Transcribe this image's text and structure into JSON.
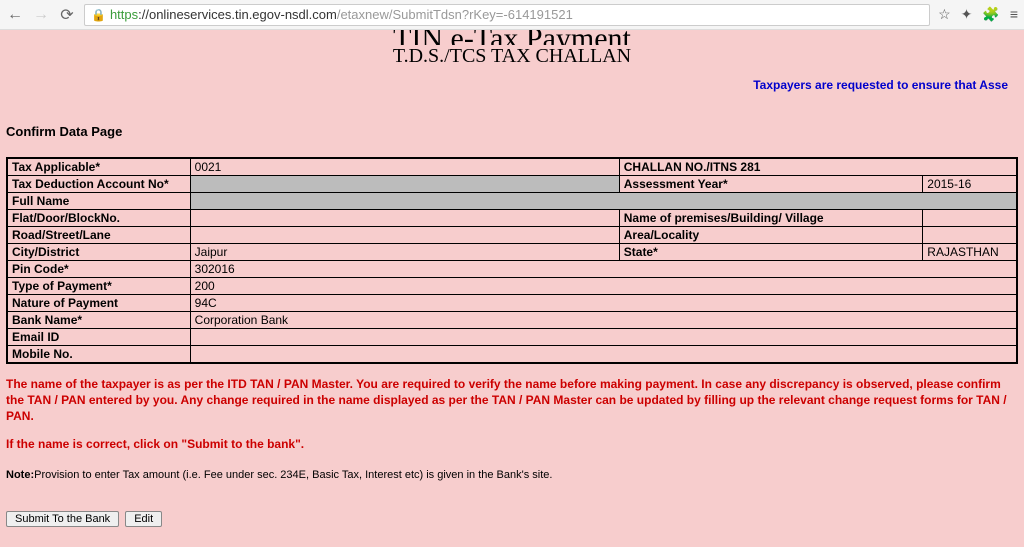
{
  "browser": {
    "url_scheme": "https",
    "url_host": "://onlineservices.tin.egov-nsdl.com",
    "url_path": "/etaxnew/SubmitTdsn?rKey=-614191521"
  },
  "header": {
    "main_title": "TIN e-Tax Payment",
    "sub_title": "T.D.S./TCS TAX CHALLAN",
    "marquee": "Taxpayers are requested to ensure that Asse"
  },
  "section_title": "Confirm Data Page",
  "form": {
    "tax_applicable_label": "Tax Applicable*",
    "tax_applicable_value": "0021",
    "challan_no_label": "CHALLAN NO./ITNS 281",
    "tan_label": "Tax Deduction Account No*",
    "tan_value": "",
    "assessment_year_label": "Assessment Year*",
    "assessment_year_value": "2015-16",
    "full_name_label": "Full Name",
    "full_name_value": "",
    "flat_label": "Flat/Door/BlockNo.",
    "flat_value": "",
    "premises_label": "Name of premises/Building/ Village",
    "premises_value": "",
    "road_label": "Road/Street/Lane",
    "road_value": "",
    "area_label": "Area/Locality",
    "area_value": "",
    "city_label": "City/District",
    "city_value": "Jaipur",
    "state_label": "State*",
    "state_value": "RAJASTHAN",
    "pin_label": "Pin Code*",
    "pin_value": "302016",
    "type_payment_label": "Type of Payment*",
    "type_payment_value": "200",
    "nature_payment_label": "Nature of Payment",
    "nature_payment_value": "94C",
    "bank_label": "Bank Name*",
    "bank_value": "Corporation Bank",
    "email_label": "Email ID",
    "email_value": "",
    "mobile_label": "Mobile No.",
    "mobile_value": ""
  },
  "messages": {
    "warn1": "The name of the taxpayer is as per the ITD TAN / PAN Master. You are required to verify the name before making payment. In case any discrepancy is observed, please confirm the TAN / PAN entered by you. Any change required in the name displayed as per the TAN / PAN Master can be updated by filling up the relevant change request forms for TAN / PAN.",
    "warn2": "If the name is correct, click on \"Submit to the bank\".",
    "note_label": "Note:",
    "note_text": "Provision to enter Tax amount (i.e. Fee under sec. 234E, Basic Tax, Interest etc) is given in the Bank's site."
  },
  "buttons": {
    "submit": "Submit To the Bank",
    "edit": "Edit"
  }
}
